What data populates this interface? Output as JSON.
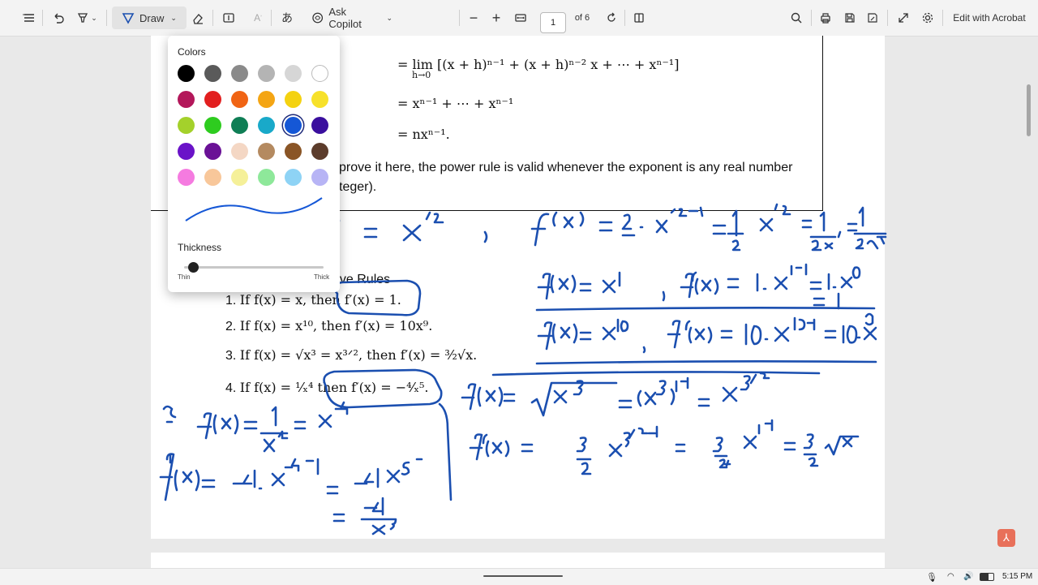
{
  "toolbar": {
    "draw_label": "Draw",
    "ask_copilot_label": "Ask Copilot",
    "page_number": "1",
    "page_total": "of 6",
    "edit_acrobat_label": "Edit with Acrobat"
  },
  "document": {
    "line1": "= lim [(x + h)ⁿ⁻¹ + (x + h)ⁿ⁻² x + ⋯ + xⁿ⁻¹]",
    "line1_sub": "h→0",
    "line2": "= xⁿ⁻¹ + ⋯ + xⁿ⁻¹",
    "line3": "= nxⁿ⁻¹.",
    "para_a": "prove it here, the power rule is valid whenever the exponent is any real number",
    "para_b": "teger).",
    "section_heading": "ove Rules",
    "rules": [
      {
        "num": "1.",
        "text": "If f(x) = x, then f′(x) = 1."
      },
      {
        "num": "2.",
        "text": "If f(x) = x¹⁰, then f′(x) = 10x⁹."
      },
      {
        "num": "3.",
        "text": "If f(x) = √x³ = x³ᐟ², then f′(x) = ³⁄₂√x."
      },
      {
        "num": "4.",
        "text": "If f(x) = ¹⁄ₓ⁴ then f′(x) = −⁴⁄ₓ⁵."
      }
    ]
  },
  "popup": {
    "colors_title": "Colors",
    "thickness_title": "Thickness",
    "thin_label": "Thin",
    "thick_label": "Thick",
    "thickness_value": 0.03,
    "colors": [
      [
        "#000000",
        "#5a5a5a",
        "#8a8a8a",
        "#b4b4b4",
        "#d6d6d6",
        "#ffffff"
      ],
      [
        "#b3175a",
        "#e21f1f",
        "#f06414",
        "#f4a514",
        "#f4d211",
        "#f7e12a"
      ],
      [
        "#a4d12b",
        "#2ecc1f",
        "#0f7e55",
        "#19a9c9",
        "#1557d6",
        "#3a0f9e"
      ],
      [
        "#6a13c8",
        "#6a1196",
        "#f4d7c4",
        "#b48a60",
        "#8a5526",
        "#5c3c2b"
      ],
      [
        "#f57be0",
        "#f8c79a",
        "#f5f099",
        "#8ee89a",
        "#8ed3f5",
        "#b7b4f5"
      ]
    ],
    "selected_color": "#1557d6"
  },
  "ink_color": "#1b4fb0",
  "taskbar": {
    "time": "5:15 PM"
  }
}
